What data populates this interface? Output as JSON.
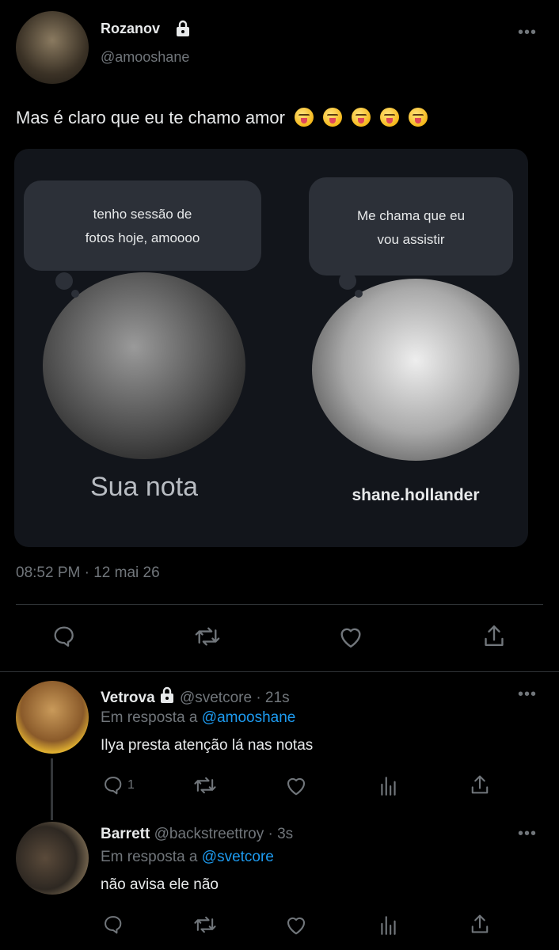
{
  "main_tweet": {
    "author_name": "Rozanov",
    "handle": "@amooshane",
    "text": "Mas é claro que eu te chamo amor",
    "emoji_count": 5,
    "emoji_icon": "squinting-face-with-tongue",
    "note_left": {
      "bubble_text_line1": "tenho sessão de",
      "bubble_text_line2": "fotos hoje, amoooo",
      "caption": "Sua nota"
    },
    "note_right": {
      "bubble_text_line1": "Me chama que eu",
      "bubble_text_line2": "vou assistir",
      "caption": "shane.hollander"
    },
    "timestamp": "08:52 PM · 12 mai 26"
  },
  "replies": [
    {
      "author_name": "Vetrova",
      "handle": "@svetcore",
      "time": "· 21s",
      "reply_prefix": "Em resposta a",
      "reply_to": "@amooshane",
      "text": "Ilya presta atenção lá nas notas",
      "reply_count": "1"
    },
    {
      "author_name": "Barrett",
      "handle": "@backstreettroy",
      "time": "· 3s",
      "reply_prefix": "Em resposta a",
      "reply_to": "@svetcore",
      "text": "não avisa ele não"
    }
  ],
  "icons": [
    "lock-icon",
    "more-icon",
    "reply-icon",
    "retweet-icon",
    "like-icon",
    "share-icon",
    "analytics-icon"
  ],
  "colors": {
    "background": "#000000",
    "text": "#e7e9ea",
    "muted": "#71767b",
    "link": "#1d9bf0",
    "card": "#12151b"
  }
}
